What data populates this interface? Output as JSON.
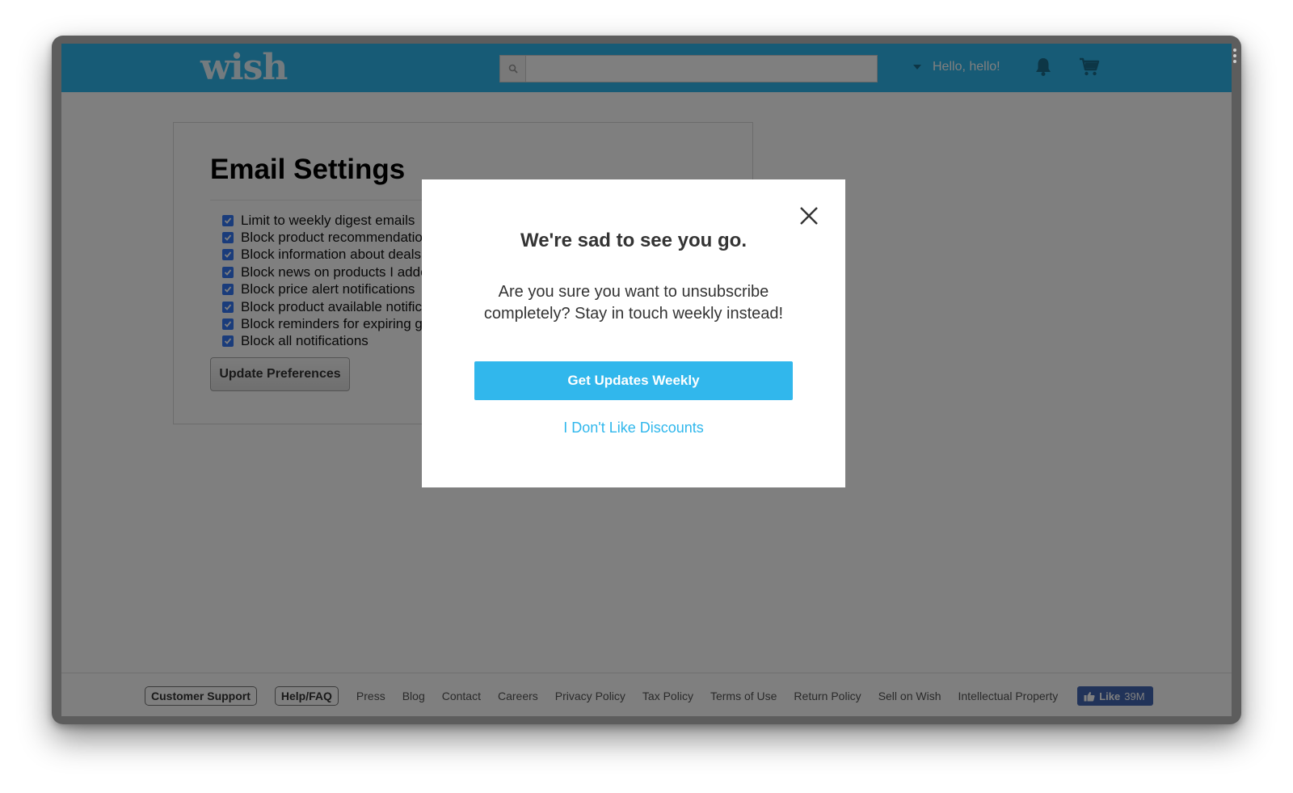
{
  "header": {
    "logo": "wish",
    "search": {
      "placeholder": "",
      "value": ""
    },
    "greeting": "Hello, hello!",
    "icons": [
      "search-icon",
      "caret-down-icon",
      "bell-icon",
      "cart-icon"
    ]
  },
  "settings": {
    "title": "Email Settings",
    "options": [
      {
        "label": "Limit to weekly digest emails",
        "checked": true
      },
      {
        "label": "Block product recommendatio",
        "checked": true
      },
      {
        "label": "Block information about deals",
        "checked": true
      },
      {
        "label": "Block news on products I adde",
        "checked": true
      },
      {
        "label": "Block price alert notifications",
        "checked": true
      },
      {
        "label": "Block product available notific",
        "checked": true
      },
      {
        "label": "Block reminders for expiring g",
        "checked": true
      },
      {
        "label": "Block all notifications",
        "checked": true
      }
    ],
    "button_label": "Update Preferences"
  },
  "modal": {
    "title": "We're sad to see you go.",
    "body": "Are you sure you want to unsubscribe completely? Stay in touch weekly instead!",
    "primary_label": "Get Updates Weekly",
    "secondary_label": "I Don't Like Discounts"
  },
  "footer": {
    "boxed_links": [
      "Customer Support",
      "Help/FAQ"
    ],
    "links": [
      "Press",
      "Blog",
      "Contact",
      "Careers",
      "Privacy Policy",
      "Tax Policy",
      "Terms of Use",
      "Return Policy",
      "Sell on Wish",
      "Intellectual Property"
    ],
    "like": {
      "label": "Like",
      "count": "39M"
    }
  },
  "colors": {
    "brand": "#2fb7ec",
    "checkbox": "#3478f6",
    "facebook": "#4267b2"
  }
}
